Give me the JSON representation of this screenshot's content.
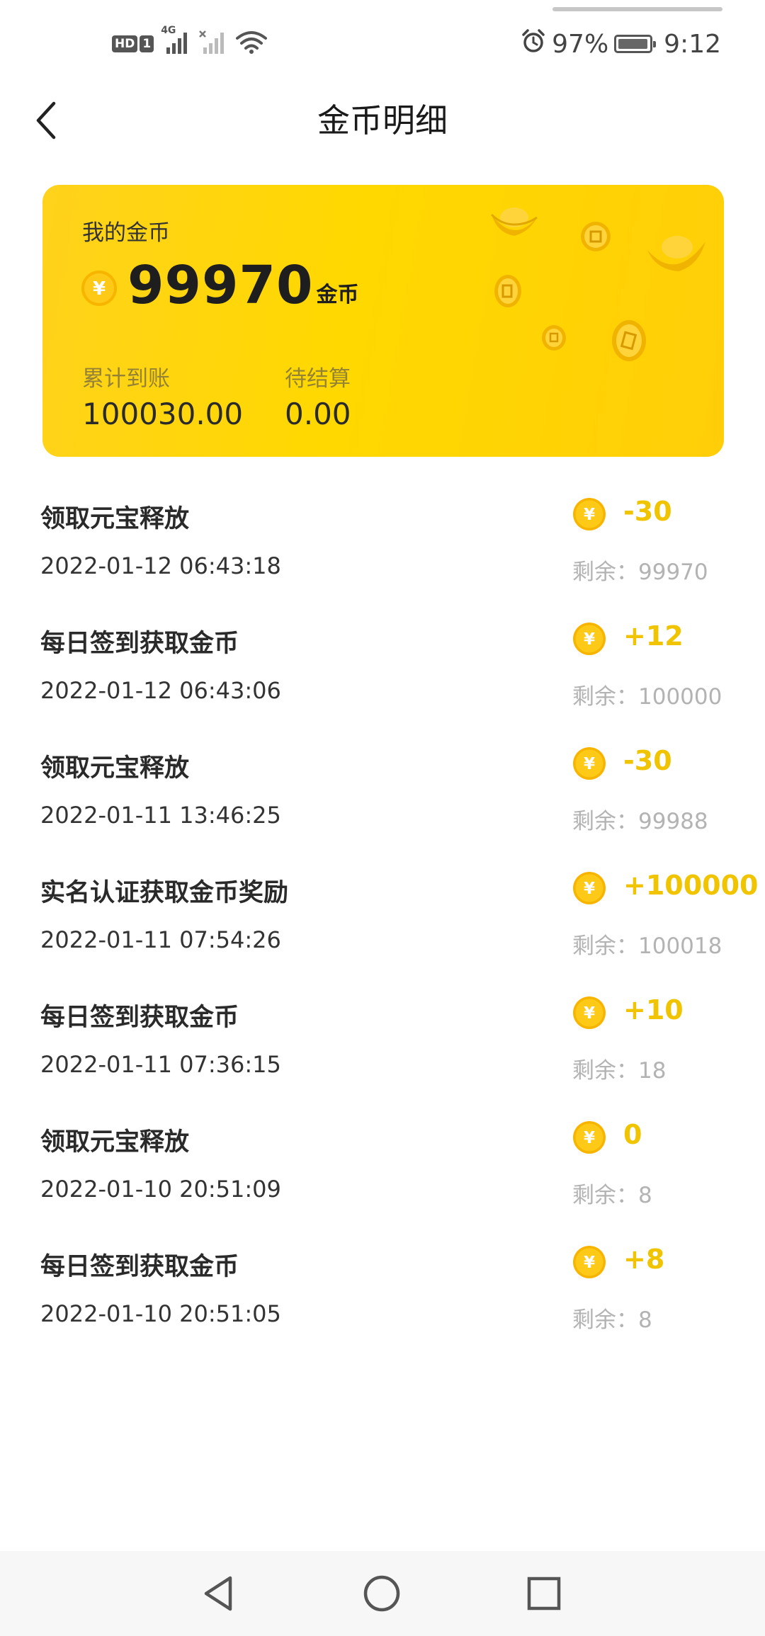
{
  "status_bar": {
    "hd_label": "HD",
    "sim_label": "1",
    "network_label": "4G",
    "battery_percent": "97%",
    "battery_level": 0.97,
    "time": "9:12",
    "icons": [
      "hd-icon",
      "signal-icon",
      "no-signal-icon",
      "wifi-icon",
      "alarm-icon",
      "battery-icon"
    ]
  },
  "header": {
    "title": "金币明细",
    "back_icon": "chevron-left-icon"
  },
  "summary": {
    "label": "我的金币",
    "balance": "99970",
    "unit": "金币",
    "coin_symbol": "¥",
    "total_received_label": "累计到账",
    "total_received_value": "100030.00",
    "pending_label": "待结算",
    "pending_value": "0.00"
  },
  "transactions": [
    {
      "title": "领取元宝释放",
      "time": "2022-01-12 06:43:18",
      "amount": "-30",
      "remaining": "剩余：99970"
    },
    {
      "title": "每日签到获取金币",
      "time": "2022-01-12 06:43:06",
      "amount": "+12",
      "remaining": "剩余：100000"
    },
    {
      "title": "领取元宝释放",
      "time": "2022-01-11 13:46:25",
      "amount": "-30",
      "remaining": "剩余：99988"
    },
    {
      "title": "实名认证获取金币奖励",
      "time": "2022-01-11 07:54:26",
      "amount": "+100000",
      "remaining": "剩余：100018"
    },
    {
      "title": "每日签到获取金币",
      "time": "2022-01-11 07:36:15",
      "amount": "+10",
      "remaining": "剩余：18"
    },
    {
      "title": "领取元宝释放",
      "time": "2022-01-10 20:51:09",
      "amount": "0",
      "remaining": "剩余：8"
    },
    {
      "title": "每日签到获取金币",
      "time": "2022-01-10 20:51:05",
      "amount": "+8",
      "remaining": "剩余：8"
    }
  ],
  "nav": {
    "back_icon": "triangle-back-icon",
    "home_icon": "circle-home-icon",
    "recents_icon": "square-recents-icon"
  },
  "colors": {
    "card_yellow": "#ffd800",
    "amount_yellow": "#f0c400",
    "coin_yellow": "#ffc800",
    "muted_gray": "#b3b3b3"
  }
}
